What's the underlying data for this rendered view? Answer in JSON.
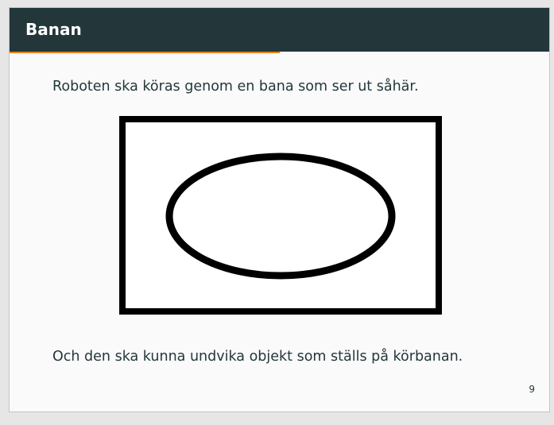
{
  "slide": {
    "title": "Banan",
    "paragraph_1": "Roboten ska köras genom en bana som ser ut såhär.",
    "paragraph_2": "Och den ska kunna undvika objekt som ställs på körbanan.",
    "page_number": "9",
    "progress_fraction": 0.5
  },
  "figure": {
    "description_icon": "track-diagram-icon",
    "stroke_color": "#000000",
    "fill_color": "#ffffff"
  },
  "colors": {
    "titlebar": "#23373b",
    "progress": "#eb811b",
    "text": "#23373b",
    "background": "#fafafa"
  }
}
